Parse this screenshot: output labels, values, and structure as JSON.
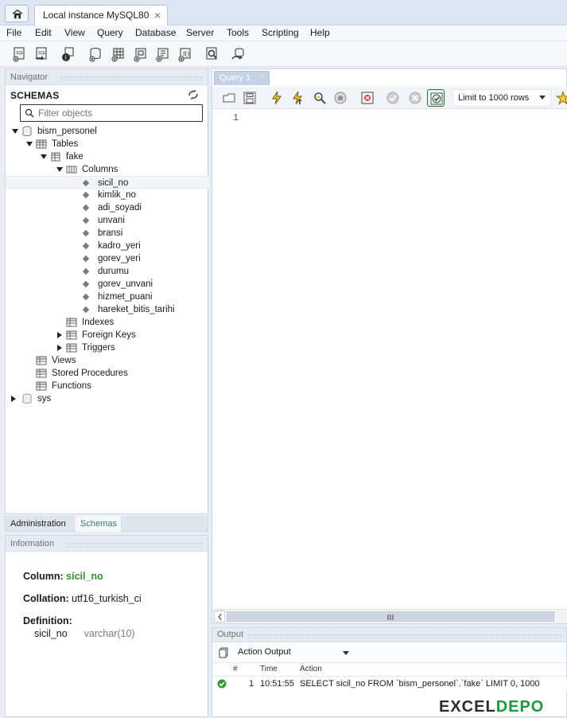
{
  "window": {
    "tab_title": "Local instance MySQL80",
    "close_glyph": "×"
  },
  "menu": [
    "File",
    "Edit",
    "View",
    "Query",
    "Database",
    "Server",
    "Tools",
    "Scripting",
    "Help"
  ],
  "navigator": {
    "header": "Navigator",
    "schemas_title": "SCHEMAS",
    "filter_placeholder": "Filter objects",
    "tree": [
      {
        "label": "bism_personel"
      },
      {
        "label": "Tables"
      },
      {
        "label": "fake"
      },
      {
        "label": "Columns"
      },
      {
        "label": "sicil_no"
      },
      {
        "label": "kimlik_no"
      },
      {
        "label": "adi_soyadi"
      },
      {
        "label": "unvani"
      },
      {
        "label": "bransi"
      },
      {
        "label": "kadro_yeri"
      },
      {
        "label": "gorev_yeri"
      },
      {
        "label": "durumu"
      },
      {
        "label": "gorev_unvani"
      },
      {
        "label": "hizmet_puani"
      },
      {
        "label": "hareket_bitis_tarihi"
      },
      {
        "label": "Indexes"
      },
      {
        "label": "Foreign Keys"
      },
      {
        "label": "Triggers"
      },
      {
        "label": "Views"
      },
      {
        "label": "Stored Procedures"
      },
      {
        "label": "Functions"
      },
      {
        "label": "sys"
      }
    ]
  },
  "left_tabs": {
    "admin": "Administration",
    "schemas": "Schemas"
  },
  "information": {
    "header": "Information",
    "column_label": "Column:",
    "column_value": "sicil_no",
    "collation_label": "Collation:",
    "collation_value": "utf16_turkish_ci",
    "definition_label": "Definition:",
    "def_name": "sicil_no",
    "def_type": "varchar(10)"
  },
  "query": {
    "tab_title": "Query 1",
    "tab_close": "×",
    "limit_label": "Limit to 1000 rows",
    "line_number": "1"
  },
  "output": {
    "header": "Output",
    "selector": "Action Output",
    "columns": {
      "num": "#",
      "time": "Time",
      "action": "Action"
    },
    "row": {
      "num": "1",
      "time": "10:51:55",
      "action": "SELECT sicil_no FROM `bism_personel`.`fake` LIMIT 0, 1000"
    }
  },
  "brand": {
    "text": "EXCEL",
    "accent": "DEPO"
  }
}
